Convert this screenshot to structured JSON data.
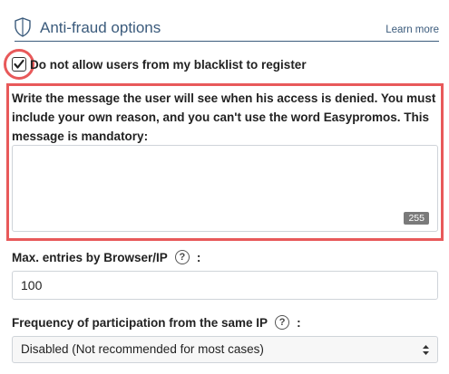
{
  "section": {
    "title": "Anti-fraud options",
    "learn_more": "Learn more"
  },
  "blacklist": {
    "label": "Do not allow users from my blacklist to register",
    "checked": true
  },
  "denied_message": {
    "label": "Write the message the user will see when his access is denied. You must include your own reason, and you can't use the word Easypromos. This message is mandatory:",
    "value": "",
    "char_counter": "255"
  },
  "max_entries": {
    "label": "Max. entries by Browser/IP",
    "colon": ":",
    "value": "100"
  },
  "frequency": {
    "label": "Frequency of participation from the same IP",
    "colon": ":",
    "selected": "Disabled (Not recommended for most cases)"
  },
  "colors": {
    "accent": "#3b5b7c",
    "highlight": "#e8595a"
  }
}
